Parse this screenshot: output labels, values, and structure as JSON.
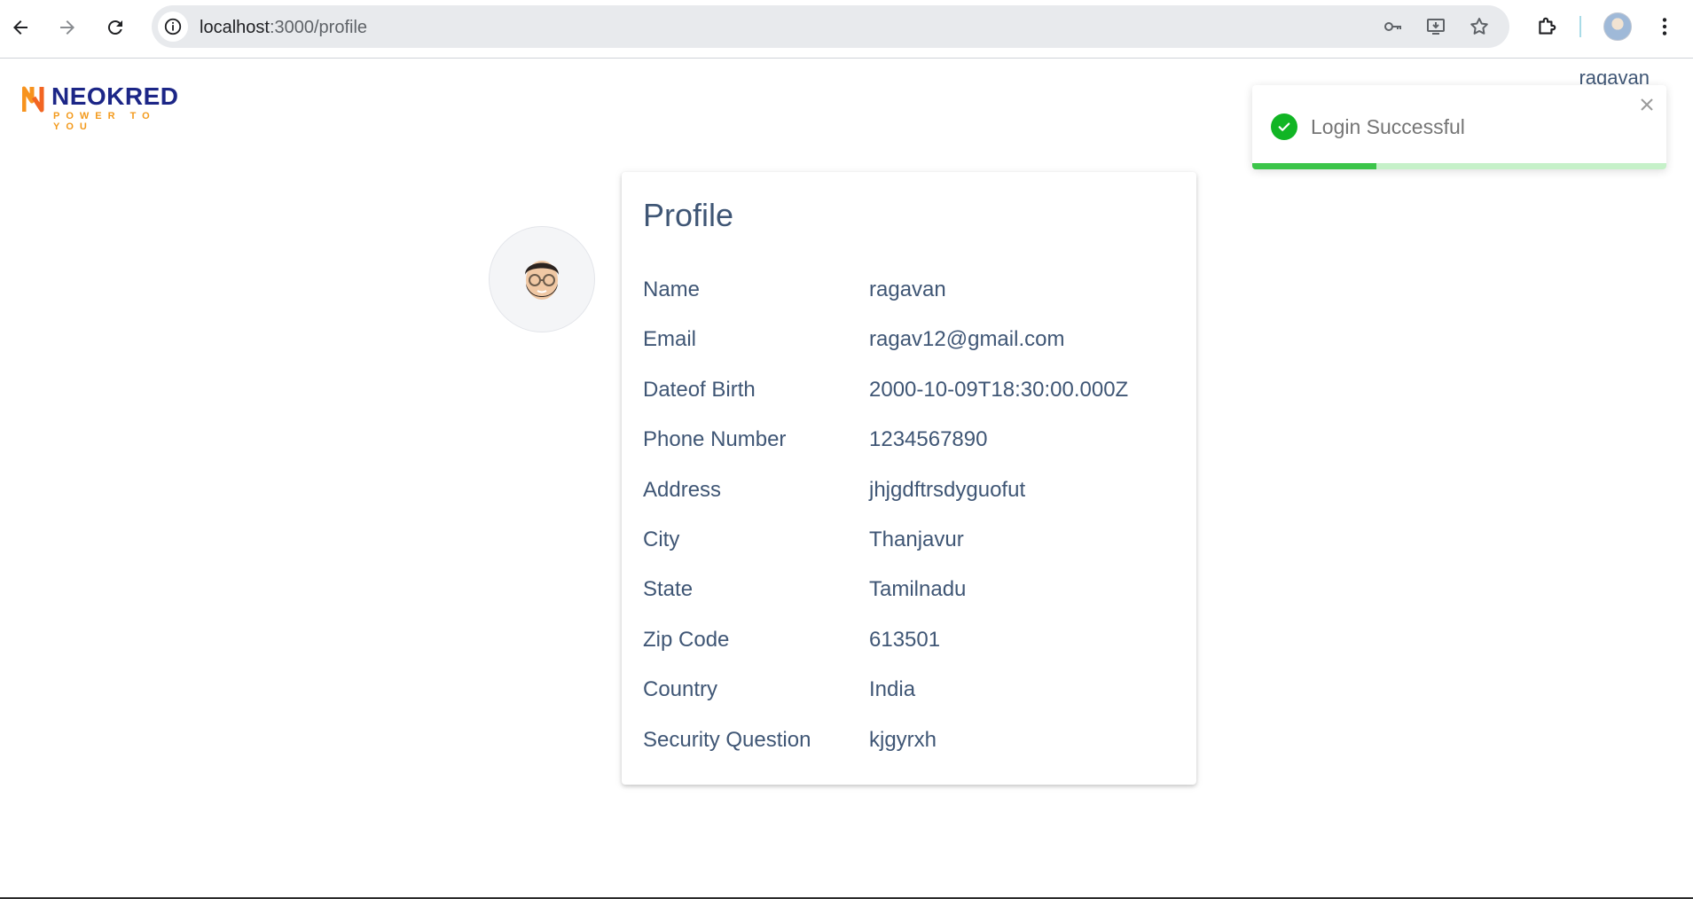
{
  "browser": {
    "url_host": "localhost",
    "url_path": ":3000/profile"
  },
  "header": {
    "logo_text": "NEOKRED",
    "logo_tagline": "POWER TO YOU",
    "username": "ragavan"
  },
  "toast": {
    "message": "Login Successful",
    "progress": 0.3,
    "colors": {
      "check": "#11b524",
      "bar": "#3cc54a",
      "track": "#c6f1c9"
    }
  },
  "profile": {
    "title": "Profile",
    "rows": [
      {
        "label": "Name",
        "value": "ragavan"
      },
      {
        "label": "Email",
        "value": "ragav12@gmail.com"
      },
      {
        "label": "Dateof Birth",
        "value": "2000-10-09T18:30:00.000Z"
      },
      {
        "label": "Phone Number",
        "value": "1234567890"
      },
      {
        "label": "Address",
        "value": "jhjgdftrsdyguofut"
      },
      {
        "label": "City",
        "value": "Thanjavur"
      },
      {
        "label": "State",
        "value": "Tamilnadu"
      },
      {
        "label": "Zip Code",
        "value": "613501"
      },
      {
        "label": "Country",
        "value": "India"
      },
      {
        "label": "Security Question",
        "value": "kjgyrxh"
      }
    ]
  },
  "icons": {
    "back": "back-arrow-icon",
    "forward": "forward-arrow-icon",
    "reload": "reload-icon",
    "site_info": "info-icon",
    "password": "key-icon",
    "install": "install-app-icon",
    "bookmark": "star-icon",
    "extensions": "puzzle-icon",
    "menu": "kebab-menu-icon",
    "avatar": "memoji-avatar-icon"
  }
}
